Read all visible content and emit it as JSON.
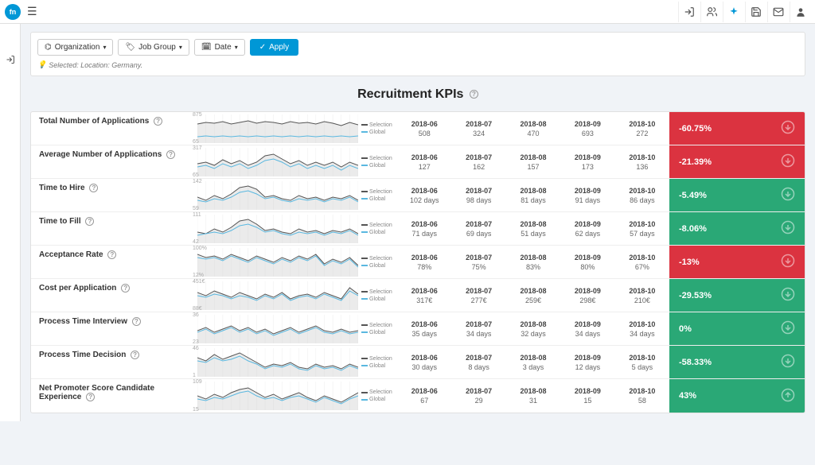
{
  "topbar": {
    "logo_text": "fn"
  },
  "filters": {
    "organization": "Organization",
    "job_group": "Job Group",
    "date": "Date",
    "apply": "Apply",
    "selected_label": "Selected: Location: Germany."
  },
  "page": {
    "title": "Recruitment KPIs"
  },
  "legend": {
    "selection": "Selection",
    "global": "Global"
  },
  "dates": [
    "2018-06",
    "2018-07",
    "2018-08",
    "2018-09",
    "2018-10"
  ],
  "kpis": [
    {
      "label": "Total Number of Applications",
      "y_top": "875",
      "y_bot": "65",
      "values": [
        "508",
        "324",
        "470",
        "693",
        "272"
      ],
      "change": "-60.75%",
      "change_color": "red",
      "arrow": "down"
    },
    {
      "label": "Average Number of Applications",
      "y_top": "317",
      "y_bot": "65",
      "values": [
        "127",
        "162",
        "157",
        "173",
        "136"
      ],
      "change": "-21.39%",
      "change_color": "red",
      "arrow": "down"
    },
    {
      "label": "Time to Hire",
      "y_top": "142",
      "y_bot": "59",
      "values": [
        "102 days",
        "98 days",
        "81 days",
        "91 days",
        "86 days"
      ],
      "change": "-5.49%",
      "change_color": "green",
      "arrow": "down"
    },
    {
      "label": "Time to Fill",
      "y_top": "111",
      "y_bot": "42",
      "values": [
        "71 days",
        "69 days",
        "51 days",
        "62 days",
        "57 days"
      ],
      "change": "-8.06%",
      "change_color": "green",
      "arrow": "down"
    },
    {
      "label": "Acceptance Rate",
      "y_top": "100%",
      "y_bot": "12%",
      "values": [
        "78%",
        "75%",
        "83%",
        "80%",
        "67%"
      ],
      "change": "-13%",
      "change_color": "red",
      "arrow": "down"
    },
    {
      "label": "Cost per Application",
      "y_top": "451€",
      "y_bot": "88€",
      "values": [
        "317€",
        "277€",
        "259€",
        "298€",
        "210€"
      ],
      "change": "-29.53%",
      "change_color": "green",
      "arrow": "down"
    },
    {
      "label": "Process Time Interview",
      "y_top": "36",
      "y_bot": "23",
      "values": [
        "35 days",
        "34 days",
        "32 days",
        "34 days",
        "34 days"
      ],
      "change": "0%",
      "change_color": "green",
      "arrow": "down"
    },
    {
      "label": "Process Time Decision",
      "y_top": "46",
      "y_bot": "1",
      "values": [
        "30 days",
        "8 days",
        "3 days",
        "12 days",
        "5 days"
      ],
      "change": "-58.33%",
      "change_color": "green",
      "arrow": "down"
    },
    {
      "label": "Net Promoter Score Candidate Experience",
      "y_top": "109",
      "y_bot": "15",
      "values": [
        "67",
        "29",
        "31",
        "15",
        "58"
      ],
      "change": "43%",
      "change_color": "green",
      "arrow": "up"
    }
  ],
  "chart_data": [
    {
      "type": "line",
      "title": "Total Number of Applications",
      "categories": [
        "2018-06",
        "2018-07",
        "2018-08",
        "2018-09",
        "2018-10"
      ],
      "series": [
        {
          "name": "Selection",
          "values": [
            508,
            324,
            470,
            693,
            272
          ]
        }
      ],
      "ylim": [
        65,
        875
      ]
    },
    {
      "type": "line",
      "title": "Average Number of Applications",
      "categories": [
        "2018-06",
        "2018-07",
        "2018-08",
        "2018-09",
        "2018-10"
      ],
      "series": [
        {
          "name": "Selection",
          "values": [
            127,
            162,
            157,
            173,
            136
          ]
        }
      ],
      "ylim": [
        65,
        317
      ]
    },
    {
      "type": "line",
      "title": "Time to Hire",
      "categories": [
        "2018-06",
        "2018-07",
        "2018-08",
        "2018-09",
        "2018-10"
      ],
      "series": [
        {
          "name": "Selection",
          "values": [
            102,
            98,
            81,
            91,
            86
          ]
        }
      ],
      "ylim": [
        59,
        142
      ]
    },
    {
      "type": "line",
      "title": "Time to Fill",
      "categories": [
        "2018-06",
        "2018-07",
        "2018-08",
        "2018-09",
        "2018-10"
      ],
      "series": [
        {
          "name": "Selection",
          "values": [
            71,
            69,
            51,
            62,
            57
          ]
        }
      ],
      "ylim": [
        42,
        111
      ]
    },
    {
      "type": "line",
      "title": "Acceptance Rate",
      "categories": [
        "2018-06",
        "2018-07",
        "2018-08",
        "2018-09",
        "2018-10"
      ],
      "series": [
        {
          "name": "Selection",
          "values": [
            78,
            75,
            83,
            80,
            67
          ]
        }
      ],
      "ylim": [
        12,
        100
      ]
    },
    {
      "type": "line",
      "title": "Cost per Application",
      "categories": [
        "2018-06",
        "2018-07",
        "2018-08",
        "2018-09",
        "2018-10"
      ],
      "series": [
        {
          "name": "Selection",
          "values": [
            317,
            277,
            259,
            298,
            210
          ]
        }
      ],
      "ylim": [
        88,
        451
      ]
    },
    {
      "type": "line",
      "title": "Process Time Interview",
      "categories": [
        "2018-06",
        "2018-07",
        "2018-08",
        "2018-09",
        "2018-10"
      ],
      "series": [
        {
          "name": "Selection",
          "values": [
            35,
            34,
            32,
            34,
            34
          ]
        }
      ],
      "ylim": [
        23,
        36
      ]
    },
    {
      "type": "line",
      "title": "Process Time Decision",
      "categories": [
        "2018-06",
        "2018-07",
        "2018-08",
        "2018-09",
        "2018-10"
      ],
      "series": [
        {
          "name": "Selection",
          "values": [
            30,
            8,
            3,
            12,
            5
          ]
        }
      ],
      "ylim": [
        1,
        46
      ]
    },
    {
      "type": "line",
      "title": "Net Promoter Score Candidate Experience",
      "categories": [
        "2018-06",
        "2018-07",
        "2018-08",
        "2018-09",
        "2018-10"
      ],
      "series": [
        {
          "name": "Selection",
          "values": [
            67,
            29,
            31,
            15,
            58
          ]
        }
      ],
      "ylim": [
        15,
        109
      ]
    }
  ]
}
